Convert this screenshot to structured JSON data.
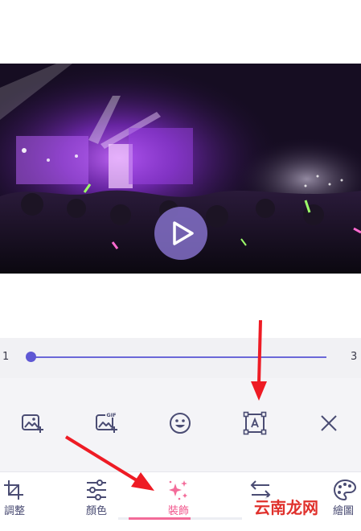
{
  "video": {
    "play_icon": "play-icon"
  },
  "slider": {
    "min_label": "1",
    "max_label": "3",
    "value": 1,
    "accent": "#5f58d4"
  },
  "decoration_tools": [
    {
      "icon": "add-image-icon"
    },
    {
      "icon": "add-gif-icon"
    },
    {
      "icon": "emoji-icon"
    },
    {
      "icon": "text-box-icon"
    },
    {
      "icon": "close-icon"
    }
  ],
  "nav": {
    "items": [
      {
        "label": "調整",
        "icon": "crop-icon",
        "active": false
      },
      {
        "label": "顏色",
        "icon": "sliders-icon",
        "active": false
      },
      {
        "label": "裝飾",
        "icon": "sparkles-icon",
        "active": true
      },
      {
        "label": "",
        "icon": "swap-arrows-icon",
        "active": false
      },
      {
        "label": "繪圖",
        "icon": "palette-icon",
        "active": false
      }
    ],
    "active_color": "#f1548b",
    "text_color": "#4a4c73"
  },
  "watermark": {
    "text": "云南龙网"
  },
  "annotation_color": "#ee1b24"
}
